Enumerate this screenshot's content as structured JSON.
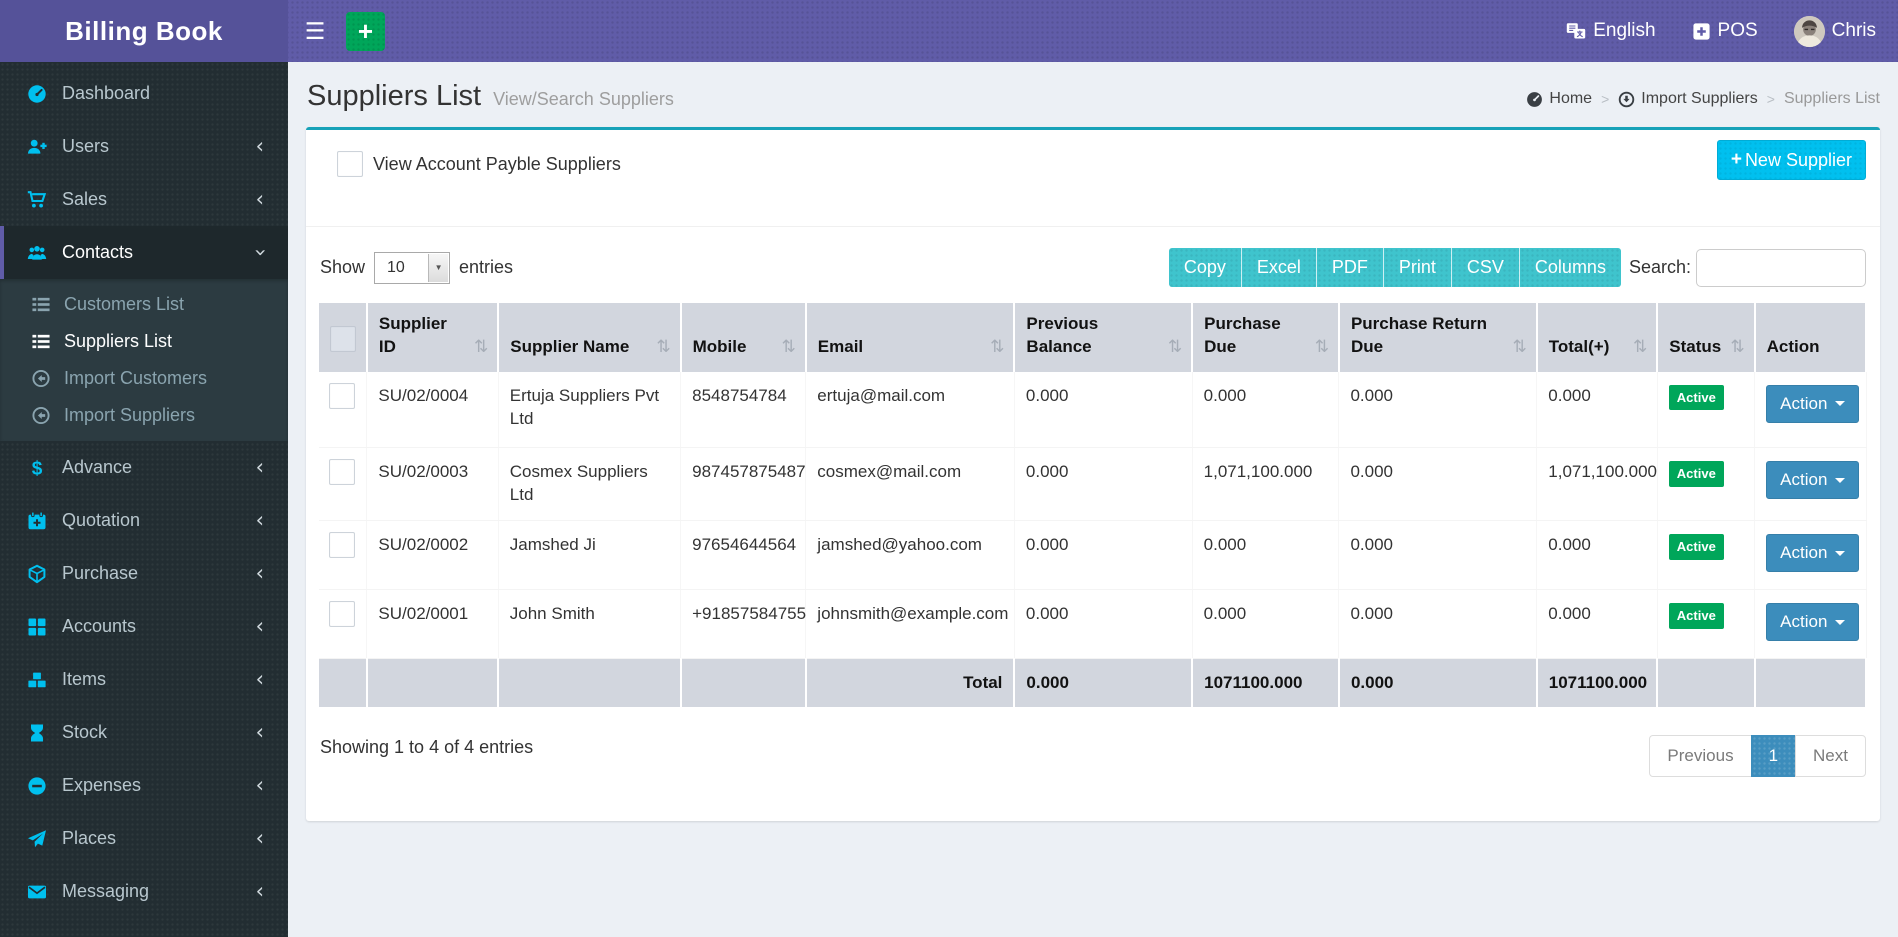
{
  "icons": {
    "menu": "☰",
    "plus": "+",
    "sort": "⇅",
    "chevron": "‹",
    "select_arrow": "▼",
    "breadcrumb_sep": ">"
  },
  "topbar": {
    "brand": "Billing Book",
    "language": "English",
    "pos": "POS",
    "user": "Chris"
  },
  "sidebar": {
    "items": [
      {
        "label": "Dashboard"
      },
      {
        "label": "Users"
      },
      {
        "label": "Sales"
      },
      {
        "label": "Contacts"
      },
      {
        "label": "Advance"
      },
      {
        "label": "Quotation"
      },
      {
        "label": "Purchase"
      },
      {
        "label": "Accounts"
      },
      {
        "label": "Items"
      },
      {
        "label": "Stock"
      },
      {
        "label": "Expenses"
      },
      {
        "label": "Places"
      },
      {
        "label": "Messaging"
      }
    ],
    "contacts_submenu": [
      {
        "label": "Customers List"
      },
      {
        "label": "Suppliers List",
        "active": true
      },
      {
        "label": "Import Customers"
      },
      {
        "label": "Import Suppliers"
      }
    ]
  },
  "page": {
    "title": "Suppliers List",
    "subtitle": "View/Search Suppliers",
    "breadcrumb": [
      "Home",
      "Import Suppliers",
      "Suppliers List"
    ]
  },
  "toolbar": {
    "payble_checkbox_label": "View Account Payble Suppliers",
    "new_supplier_label": "New Supplier",
    "show_label": "Show",
    "page_length": "10",
    "entries_label": "entries",
    "export_buttons": [
      "Copy",
      "Excel",
      "PDF",
      "Print",
      "CSV",
      "Columns"
    ],
    "search_label": "Search:",
    "search_value": ""
  },
  "table": {
    "headers": [
      "Supplier ID",
      "Supplier Name",
      "Mobile",
      "Email",
      "Previous Balance",
      "Purchase Due",
      "Purchase Return Due",
      "Total(+)",
      "Status",
      "Action"
    ],
    "rows": [
      {
        "supplier_id": "SU/02/0004",
        "supplier_name": "Ertuja Suppliers Pvt Ltd",
        "mobile": "8548754784",
        "email": "ertuja@mail.com",
        "previous_balance": "0.000",
        "purchase_due": "0.000",
        "purchase_return_due": "0.000",
        "total": "0.000",
        "status": "Active",
        "action_label": "Action"
      },
      {
        "supplier_id": "SU/02/0003",
        "supplier_name": "Cosmex Suppliers Ltd",
        "mobile": "987457875487",
        "email": "cosmex@mail.com",
        "previous_balance": "0.000",
        "purchase_due": "1,071,100.000",
        "purchase_return_due": "0.000",
        "total": "1,071,100.000",
        "status": "Active",
        "action_label": "Action"
      },
      {
        "supplier_id": "SU/02/0002",
        "supplier_name": "Jamshed Ji",
        "mobile": "97654644564",
        "email": "jamshed@yahoo.com",
        "previous_balance": "0.000",
        "purchase_due": "0.000",
        "purchase_return_due": "0.000",
        "total": "0.000",
        "status": "Active",
        "action_label": "Action"
      },
      {
        "supplier_id": "SU/02/0001",
        "supplier_name": "John Smith",
        "mobile": "+91857584755",
        "email": "johnsmith@example.com",
        "previous_balance": "0.000",
        "purchase_due": "0.000",
        "purchase_return_due": "0.000",
        "total": "0.000",
        "status": "Active",
        "action_label": "Action"
      }
    ],
    "total_row": {
      "label": "Total",
      "previous_balance": "0.000",
      "purchase_due": "1071100.000",
      "purchase_return_due": "0.000",
      "total": "1071100.000"
    }
  },
  "footer": {
    "showing_text": "Showing 1 to 4 of 4 entries",
    "previous": "Previous",
    "current_page": "1",
    "next": "Next"
  },
  "colors": {
    "navbar": "#605ca8",
    "logo_bg": "#555299",
    "sidebar_bg": "#222d32",
    "submenu_bg": "#2c3b41",
    "accent_cyan": "#00c0ef",
    "green": "#00a65a",
    "teal_button": "#3fc4cd",
    "box_top_border": "#17a2b8",
    "blue": "#3c8dbc",
    "table_header_bg": "#d2d6de",
    "content_bg": "#ecf0f5"
  }
}
